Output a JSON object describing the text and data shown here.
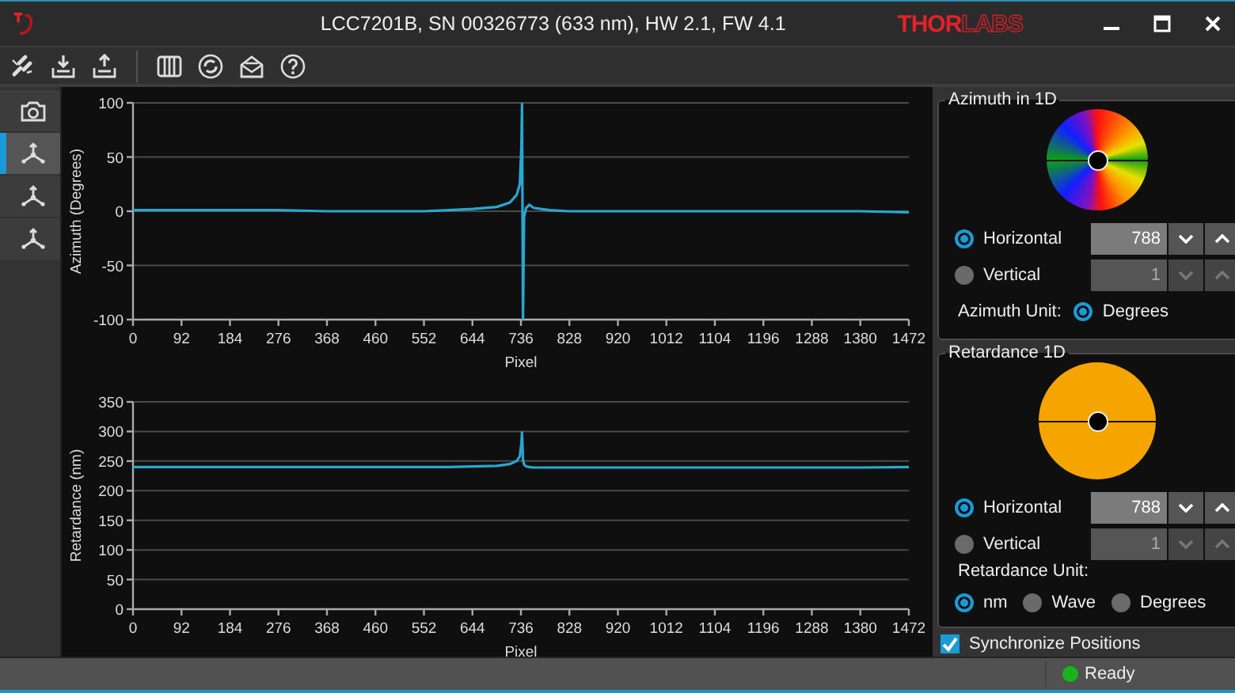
{
  "window": {
    "title": "LCC7201B, SN 00326773 (633 nm), HW 2.1, FW 4.1",
    "logo": {
      "solid": "THOR",
      "outline": "LABS"
    }
  },
  "sidebar": {
    "items": [
      {
        "kind": "camera",
        "selected": false
      },
      {
        "kind": "axes",
        "selected": true
      },
      {
        "kind": "axes",
        "selected": false
      },
      {
        "kind": "axes",
        "selected": false
      }
    ]
  },
  "charts": [
    {
      "chart_data": {
        "type": "line",
        "xlabel": "Pixel",
        "ylabel": "Azimuth (Degrees)",
        "xlim": [
          0,
          1472
        ],
        "ylim": [
          -100,
          100
        ],
        "xticks": [
          0,
          92,
          184,
          276,
          368,
          460,
          552,
          644,
          736,
          828,
          920,
          1012,
          1104,
          1196,
          1288,
          1380,
          1472
        ],
        "yticks": [
          -100,
          -50,
          0,
          50,
          100
        ],
        "x": [
          0,
          92,
          184,
          276,
          368,
          460,
          552,
          600,
          644,
          690,
          715,
          728,
          734,
          737,
          738,
          740,
          742,
          746,
          752,
          760,
          790,
          828,
          920,
          1012,
          1104,
          1196,
          1288,
          1380,
          1472
        ],
        "grid": true,
        "series": [
          {
            "color": "#2aa7d0",
            "values": [
              1,
              1,
              1,
              1,
              0,
              0,
              0,
              1,
              2,
              4,
              8,
              15,
              25,
              60,
              100,
              -100,
              -5,
              3,
              6,
              3,
              1,
              0,
              0,
              0,
              0,
              0,
              0,
              0,
              -1
            ]
          }
        ]
      }
    },
    {
      "chart_data": {
        "type": "line",
        "xlabel": "Pixel",
        "ylabel": "Retardance (nm)",
        "xlim": [
          0,
          1472
        ],
        "ylim": [
          0,
          350
        ],
        "xticks": [
          0,
          92,
          184,
          276,
          368,
          460,
          552,
          644,
          736,
          828,
          920,
          1012,
          1104,
          1196,
          1288,
          1380,
          1472
        ],
        "yticks": [
          0,
          50,
          100,
          150,
          200,
          250,
          300,
          350
        ],
        "x": [
          0,
          92,
          184,
          276,
          368,
          460,
          552,
          600,
          644,
          690,
          715,
          728,
          734,
          737,
          738,
          740,
          742,
          746,
          752,
          760,
          790,
          828,
          920,
          1012,
          1104,
          1196,
          1288,
          1380,
          1472
        ],
        "grid": true,
        "series": [
          {
            "color": "#2aa7d0",
            "values": [
              240,
              240,
              240,
              240,
              240,
              240,
              240,
              240,
              241,
              242,
              245,
              250,
              258,
              280,
              300,
              252,
              244,
              241,
              240,
              239,
              239,
              239,
              239,
              239,
              239,
              239,
              239,
              239,
              240
            ]
          }
        ]
      }
    }
  ],
  "panels": [
    {
      "kind": "azimuth",
      "title": "Azimuth in 1D",
      "positions": [
        {
          "label": "Horizontal",
          "selected": true,
          "value": "788",
          "disabled": false
        },
        {
          "label": "Vertical",
          "selected": false,
          "value": "1",
          "disabled": true
        }
      ],
      "unit_label": "Azimuth Unit:",
      "units": [
        {
          "label": "Degrees",
          "selected": true
        }
      ]
    },
    {
      "kind": "retardance",
      "title": "Retardance 1D",
      "positions": [
        {
          "label": "Horizontal",
          "selected": true,
          "value": "788",
          "disabled": false
        },
        {
          "label": "Vertical",
          "selected": false,
          "value": "1",
          "disabled": true
        }
      ],
      "unit_label": "Retardance Unit:",
      "units": [
        {
          "label": "nm",
          "selected": true
        },
        {
          "label": "Wave",
          "selected": false
        },
        {
          "label": "Degrees",
          "selected": false
        }
      ]
    }
  ],
  "sync": {
    "label": "Synchronize Positions",
    "checked": true
  },
  "status_bar": {
    "text": "Ready"
  }
}
